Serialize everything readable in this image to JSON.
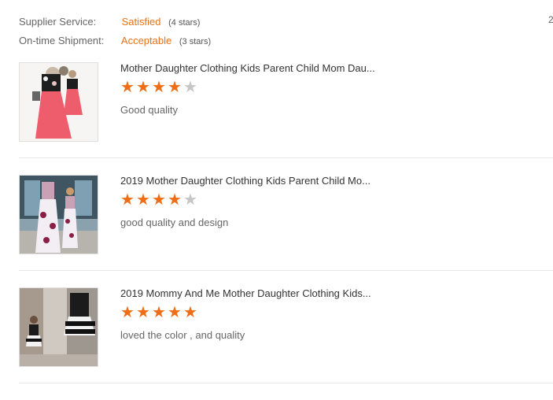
{
  "summary": {
    "supplier_label": "Supplier Service:",
    "supplier_rating": "Satisfied",
    "supplier_stars": "(4 stars)",
    "shipment_label": "On-time Shipment:",
    "shipment_rating": "Acceptable",
    "shipment_stars": "(3 stars)",
    "corner_text": "2"
  },
  "reviews": [
    {
      "title": "Mother Daughter Clothing Kids Parent Child Mom Dau...",
      "rating": 4,
      "comment": "Good quality"
    },
    {
      "title": "2019 Mother Daughter Clothing Kids Parent Child Mo...",
      "rating": 4,
      "comment": "good quality and design"
    },
    {
      "title": "2019 Mommy And Me Mother Daughter Clothing Kids...",
      "rating": 5,
      "comment": "loved the color , and quality"
    }
  ],
  "colors": {
    "accent": "#e8731a",
    "star_on": "#f06d16",
    "star_off": "#c6c6c6"
  }
}
